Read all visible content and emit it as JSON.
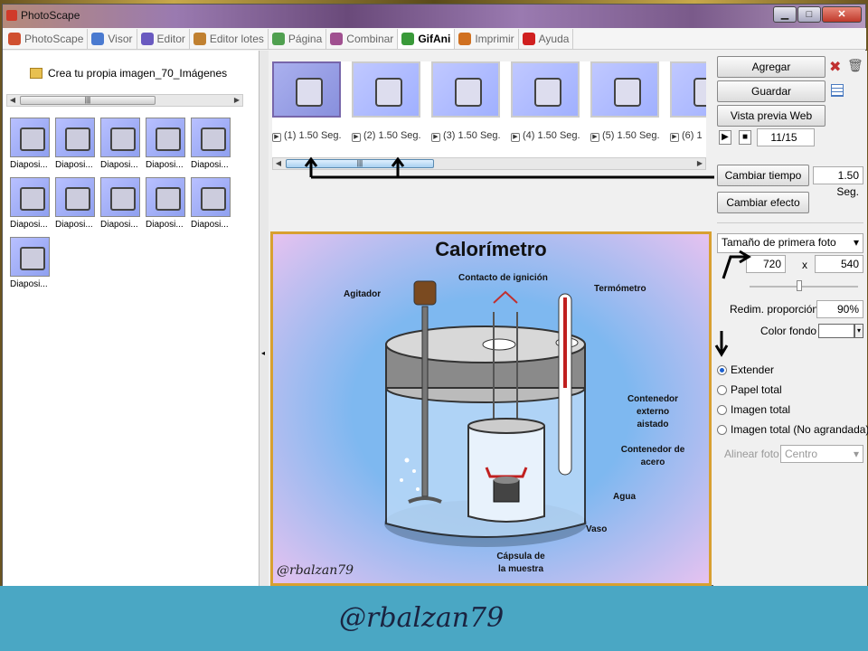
{
  "window": {
    "title": "PhotoScape",
    "buttons": [
      "▁",
      "□",
      "✕"
    ]
  },
  "menu": [
    {
      "label": "PhotoScape",
      "icon": "photoscape-icon",
      "color": "#d05030"
    },
    {
      "label": "Visor",
      "icon": "viewer-icon",
      "color": "#4a7ad0"
    },
    {
      "label": "Editor",
      "icon": "editor-icon",
      "color": "#6a5ac0"
    },
    {
      "label": "Editor lotes",
      "icon": "batch-editor-icon",
      "color": "#c08030"
    },
    {
      "label": "Página",
      "icon": "page-icon",
      "color": "#50a050"
    },
    {
      "label": "Combinar",
      "icon": "combine-icon",
      "color": "#a05090"
    },
    {
      "label": "GifAni",
      "icon": "gifani-icon",
      "color": "#3a9a3a",
      "active": true
    },
    {
      "label": "Imprimir",
      "icon": "print-icon",
      "color": "#d07020"
    },
    {
      "label": "Ayuda",
      "icon": "help-icon",
      "color": "#d02020"
    }
  ],
  "tree": {
    "folder": "Crea tu propia imagen_70_Imágenes"
  },
  "thumbnails": [
    "Diaposi...",
    "Diaposi...",
    "Diaposi...",
    "Diaposi...",
    "Diaposi...",
    "Diaposi...",
    "Diaposi...",
    "Diaposi...",
    "Diaposi...",
    "Diaposi...",
    "Diaposi..."
  ],
  "frames": [
    {
      "label": "(1) 1.50 Seg."
    },
    {
      "label": "(2) 1.50 Seg."
    },
    {
      "label": "(3) 1.50 Seg."
    },
    {
      "label": "(4) 1.50 Seg."
    },
    {
      "label": "(5) 1.50 Seg."
    },
    {
      "label": "(6) 1"
    }
  ],
  "preview": {
    "title": "Calorímetro",
    "labels": {
      "agitador": "Agitador",
      "contacto": "Contacto de ignición",
      "termometro": "Termómetro",
      "contenedor_externo": "Contenedor externo aistado",
      "contenedor_acero": "Contenedor de acero",
      "agua": "Agua",
      "vaso": "Vaso",
      "capsula": "Cápsula de la muestra"
    },
    "watermark": "@rbalzan79"
  },
  "right": {
    "agregar": "Agregar",
    "guardar": "Guardar",
    "vista_previa": "Vista previa Web",
    "counter": "11/15",
    "cambiar_tiempo": "Cambiar tiempo",
    "tiempo_value": "1.50 Seg.",
    "cambiar_efecto": "Cambiar efecto",
    "size_select": "Tamaño de primera foto",
    "width": "720",
    "x_label": "x",
    "height": "540",
    "redim_label": "Redim. proporción",
    "redim_value": "90%",
    "color_fondo": "Color fondo",
    "radios": [
      {
        "label": "Extender",
        "checked": true
      },
      {
        "label": "Papel total",
        "checked": false
      },
      {
        "label": "Imagen total",
        "checked": false
      },
      {
        "label": "Imagen total (No agrandada)",
        "checked": false
      }
    ],
    "alinear_label": "Alinear foto",
    "alinear_value": "Centro"
  },
  "footer": {
    "watermark": "@rbalzan79"
  }
}
